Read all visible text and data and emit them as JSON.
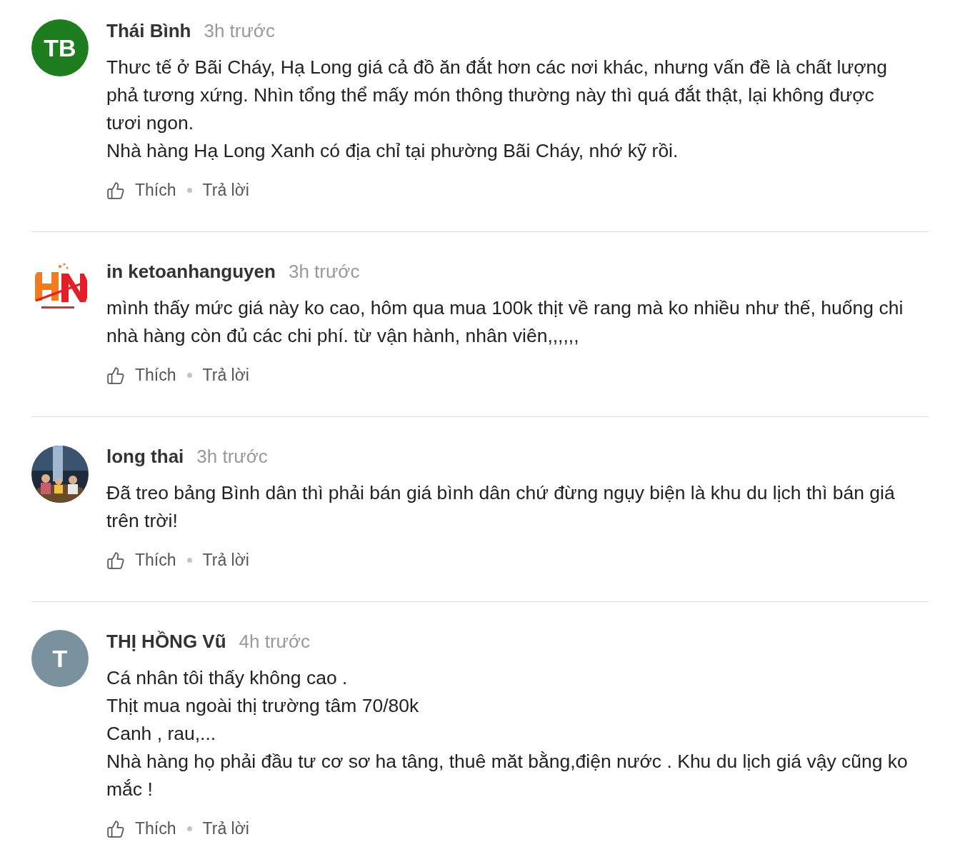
{
  "comments": [
    {
      "author": "Thái Bình",
      "time": "3h trước",
      "avatar": {
        "kind": "initials",
        "text": "TB",
        "color": "#1e7d1e"
      },
      "paragraphs": [
        "Thưc tế ở Bãi Cháy, Hạ Long giá cả đồ ăn đắt hơn các nơi khác, nhưng vấn đề là chất lượng phả tương xứng. Nhìn tổng thể mấy món thông thường này thì quá đắt thật, lại không được tươi ngon.",
        "Nhà hàng Hạ Long Xanh có địa chỉ tại phường Bãi Cháy, nhớ kỹ rồi."
      ],
      "like": "Thích",
      "reply": "Trả lời"
    },
    {
      "author": "in ketoanhanguyen",
      "time": "3h trước",
      "avatar": {
        "kind": "logo"
      },
      "paragraphs": [
        "mình thấy mức giá này ko cao, hôm qua mua 100k thịt về rang mà ko nhiều như thế, huống chi nhà hàng còn đủ các chi phí. từ vận hành, nhân viên,,,,,,"
      ],
      "like": "Thích",
      "reply": "Trả lời"
    },
    {
      "author": "long thai",
      "time": "3h trước",
      "avatar": {
        "kind": "picture"
      },
      "paragraphs": [
        "Đã treo bảng Bình dân thì phải bán giá bình dân chứ đừng ngụy biện là khu du lịch thì bán giá trên trời!"
      ],
      "like": "Thích",
      "reply": "Trả lời"
    },
    {
      "author": "THỊ HỒNG Vũ",
      "time": "4h trước",
      "avatar": {
        "kind": "initials",
        "text": "T",
        "color": "#7a929e"
      },
      "paragraphs": [
        "Cá nhân tôi thấy không cao .",
        "Thịt mua ngoài thị trường tâm 70/80k",
        "Canh , rau,...",
        "Nhà hàng họ phải đầu tư cơ sơ ha tâng, thuê măt bằng,điện nước . Khu du lịch giá vậy cũng ko mắc !"
      ],
      "like": "Thích",
      "reply": "Trả lời"
    }
  ]
}
